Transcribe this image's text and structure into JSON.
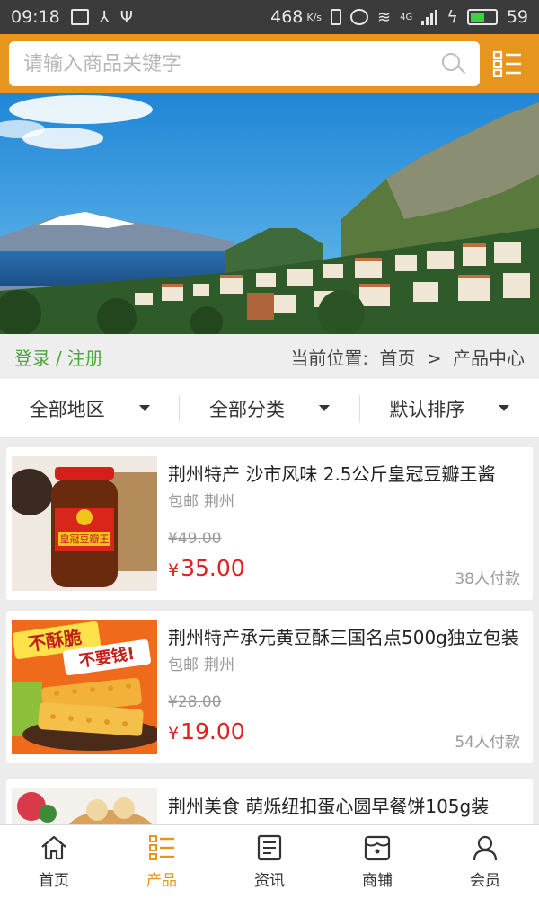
{
  "status_bar": {
    "time": "09:18",
    "speed": "468",
    "speed_unit": "K/s",
    "battery": "59",
    "battery_level": 0.59,
    "network": "4G"
  },
  "search": {
    "placeholder": "请输入商品关键字",
    "icon": "search-icon",
    "menu_icon": "list-menu-icon"
  },
  "user": {
    "login": "登录",
    "divider": "/",
    "register": "注册"
  },
  "breadcrumb": {
    "prefix": "当前位置:",
    "home": "首页",
    "separator": ">",
    "current": "产品中心"
  },
  "filters": [
    {
      "label": "全部地区"
    },
    {
      "label": "全部分类"
    },
    {
      "label": "默认排序"
    }
  ],
  "products": [
    {
      "title": "荆州特产 沙市风味 2.5公斤皇冠豆瓣王酱",
      "shipping": "包邮",
      "origin": "荆州",
      "old_price": "¥49.00",
      "currency": "¥",
      "price": "35.00",
      "sold": "38人付款",
      "image_label": "皇冠豆瓣王"
    },
    {
      "title": "荆州特产承元黄豆酥三国名点500g独立包装",
      "shipping": "包邮",
      "origin": "荆州",
      "old_price": "¥28.00",
      "currency": "¥",
      "price": "19.00",
      "sold": "54人付款",
      "image_label_1": "不酥脆",
      "image_label_2": "不要钱!"
    },
    {
      "title": "荆州美食 萌烁纽扣蛋心圆早餐饼105g装"
    }
  ],
  "tabs": [
    {
      "label": "首页",
      "icon": "home-icon",
      "active": false
    },
    {
      "label": "产品",
      "icon": "product-list-icon",
      "active": true
    },
    {
      "label": "资讯",
      "icon": "news-icon",
      "active": false
    },
    {
      "label": "商铺",
      "icon": "shop-icon",
      "active": false
    },
    {
      "label": "会员",
      "icon": "user-icon",
      "active": false
    }
  ],
  "colors": {
    "brand": "#e6951f",
    "price": "#e02020",
    "login": "#4aa63a"
  }
}
